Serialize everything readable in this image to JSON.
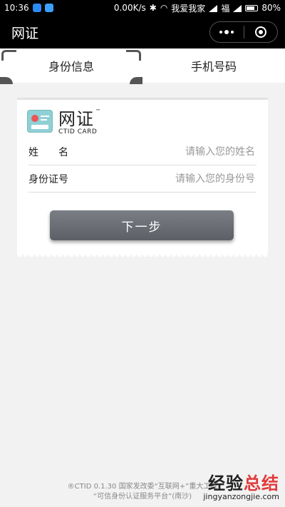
{
  "status_bar": {
    "time": "10:36",
    "speed": "0.00K/s",
    "carrier1": "我爱我家",
    "carrier2": "福",
    "battery": "80%"
  },
  "titlebar": {
    "title": "网证"
  },
  "tabs": [
    {
      "label": "身份信息",
      "active": true
    },
    {
      "label": "手机号码",
      "active": false
    }
  ],
  "brand": {
    "name": "网证",
    "tm": "™",
    "sub": "CTID CARD"
  },
  "form": {
    "name_label": "姓　　名",
    "name_placeholder": "请输入您的姓名",
    "id_label": "身份证号",
    "id_placeholder": "请输入您的身份号"
  },
  "next_button": "下一步",
  "footer": {
    "line1": "®CTID 0.1.30 国家发改委“互联网+”重大工程",
    "line2": "“可信身份认证服务平台”(南沙)"
  },
  "watermark": {
    "cn_black": "经验",
    "cn_red": "总结",
    "url": "jingyanzongjie.com"
  },
  "colors": {
    "accent_button": "#6a6e74",
    "header_bg": "#000000",
    "idcard": "#8fd0d6"
  }
}
